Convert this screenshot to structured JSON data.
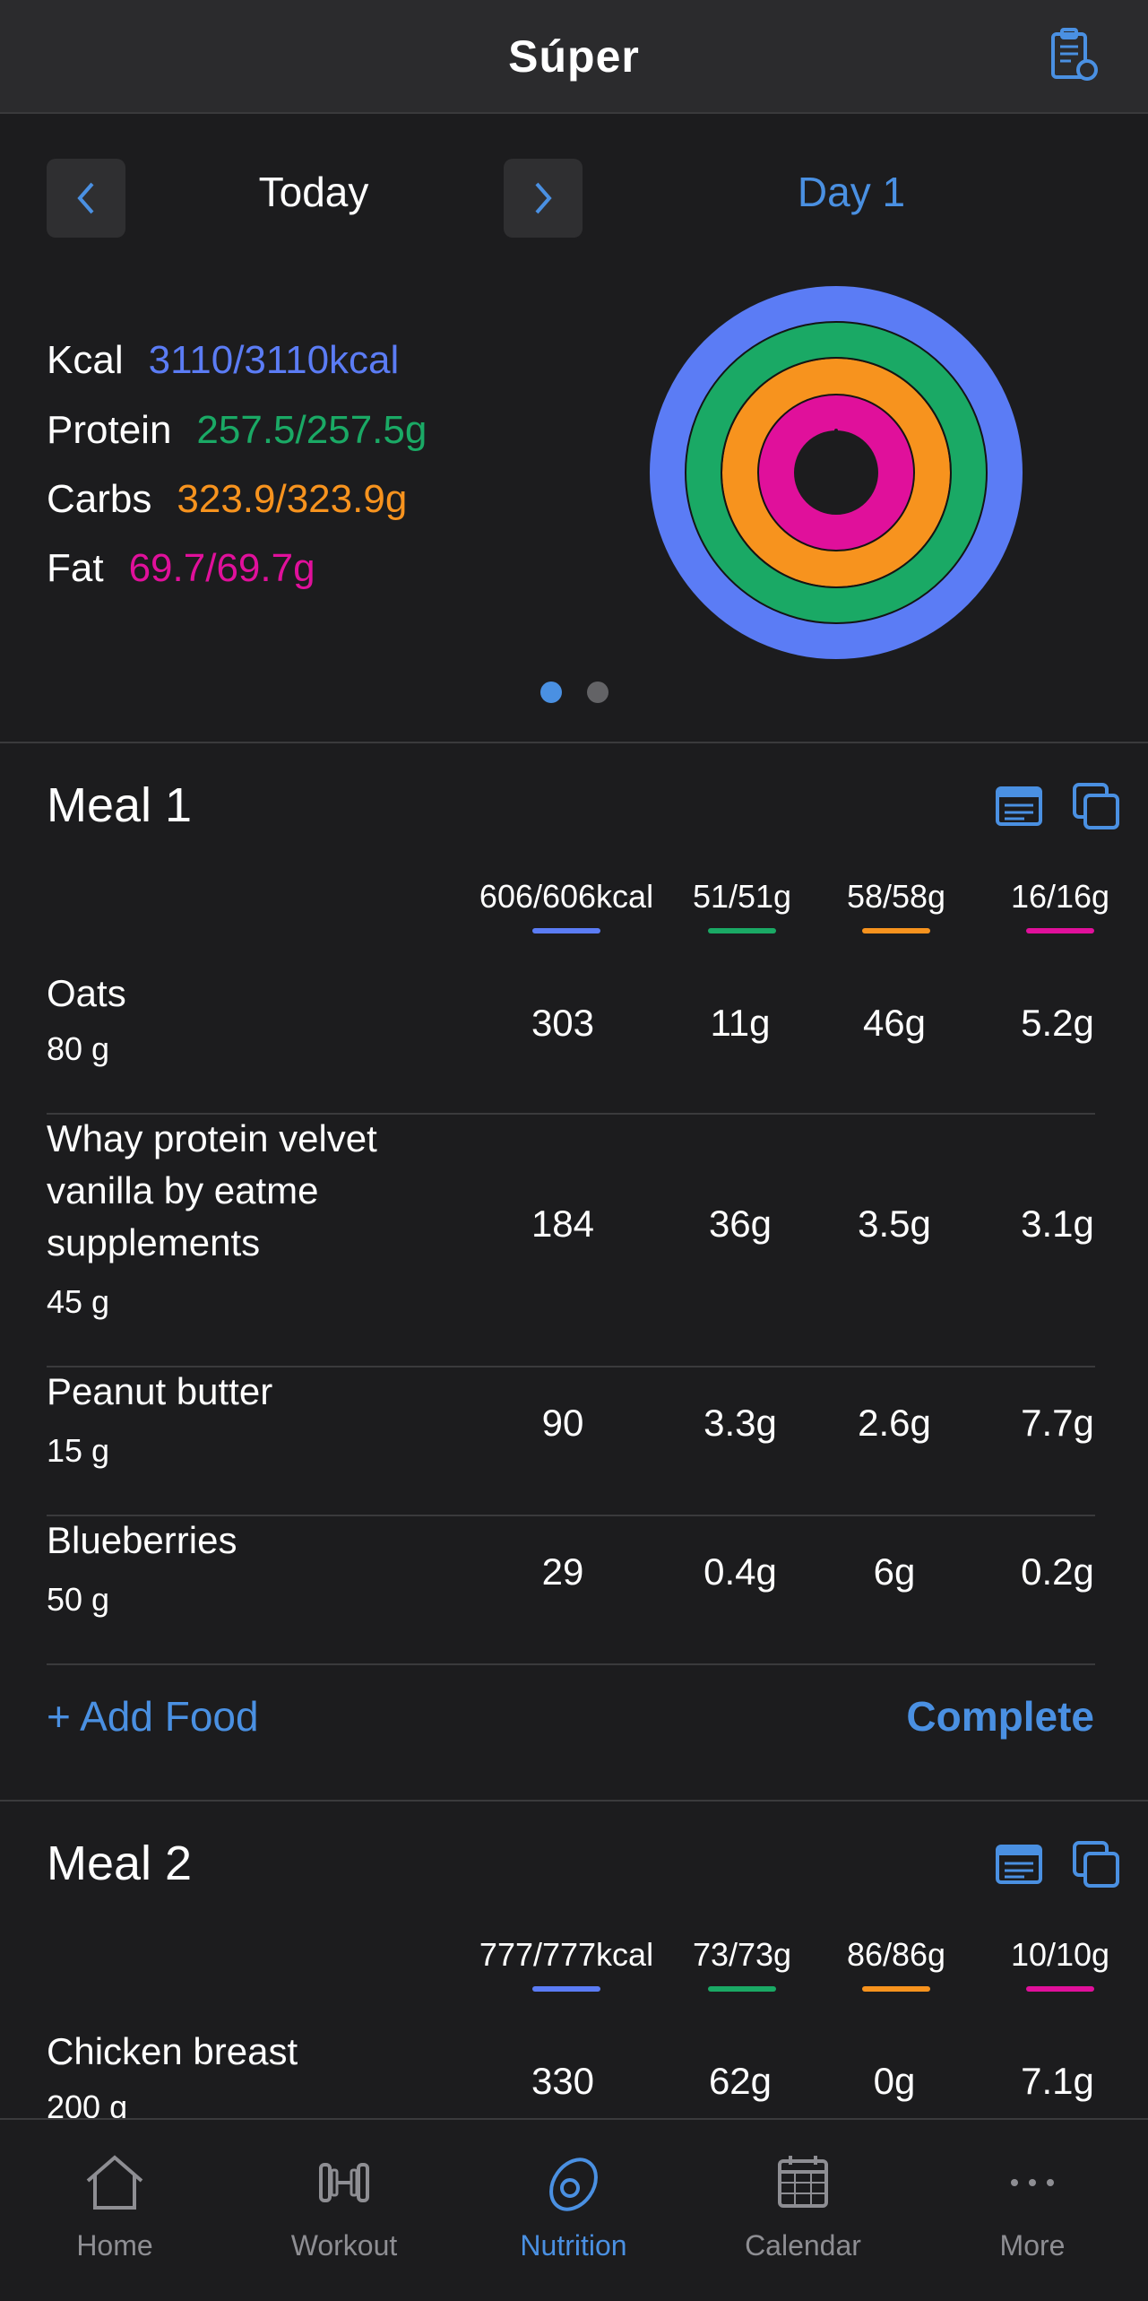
{
  "header": {
    "title": "Súper",
    "icon": "clipboard-apple-icon"
  },
  "summary": {
    "date_label": "Today",
    "day_label": "Day 1",
    "macros": [
      {
        "label": "Kcal",
        "value": "3110/3110kcal",
        "color": "#5b7cf5"
      },
      {
        "label": "Protein",
        "value": "257.5/257.5g",
        "color": "#1aa965"
      },
      {
        "label": "Carbs",
        "value": "323.9/323.9g",
        "color": "#f7931e"
      },
      {
        "label": "Fat",
        "value": "69.7/69.7g",
        "color": "#e0109b"
      }
    ],
    "rings": {
      "kcal": 1.0,
      "protein": 1.0,
      "carbs": 1.0,
      "fat": 1.0
    },
    "page_indicator": {
      "pages": 2,
      "active": 1
    }
  },
  "meals": [
    {
      "title": "Meal 1",
      "totals": {
        "kcal": "606/606kcal",
        "protein": "51/51g",
        "carbs": "58/58g",
        "fat": "16/16g"
      },
      "foods": [
        {
          "name": "Oats",
          "amount": "80 g",
          "kcal": "303",
          "protein": "11g",
          "carbs": "46g",
          "fat": "5.2g"
        },
        {
          "name": "Whay protein velvet vanilla by eatme supplements",
          "amount": "45 g",
          "kcal": "184",
          "protein": "36g",
          "carbs": "3.5g",
          "fat": "3.1g"
        },
        {
          "name": "Peanut butter",
          "amount": "15 g",
          "kcal": "90",
          "protein": "3.3g",
          "carbs": "2.6g",
          "fat": "7.7g"
        },
        {
          "name": "Blueberries",
          "amount": "50 g",
          "kcal": "29",
          "protein": "0.4g",
          "carbs": "6g",
          "fat": "0.2g"
        }
      ],
      "add_food_label": "+ Add Food",
      "complete_label": "Complete"
    },
    {
      "title": "Meal 2",
      "totals": {
        "kcal": "777/777kcal",
        "protein": "73/73g",
        "carbs": "86/86g",
        "fat": "10/10g"
      },
      "foods": [
        {
          "name": "Chicken breast",
          "amount": "200 g",
          "kcal": "330",
          "protein": "62g",
          "carbs": "0g",
          "fat": "7.1g"
        }
      ]
    }
  ],
  "tabs": [
    {
      "label": "Home",
      "icon": "home-icon",
      "active": false
    },
    {
      "label": "Workout",
      "icon": "dumbbell-icon",
      "active": false
    },
    {
      "label": "Nutrition",
      "icon": "avocado-icon",
      "active": true
    },
    {
      "label": "Calendar",
      "icon": "calendar-icon",
      "active": false
    },
    {
      "label": "More",
      "icon": "more-icon",
      "active": false
    }
  ],
  "colors": {
    "accent": "#4a90e2",
    "kcal": "#5b7cf5",
    "protein": "#1aa965",
    "carbs": "#f7931e",
    "fat": "#e0109b",
    "background": "#1c1c1e"
  }
}
